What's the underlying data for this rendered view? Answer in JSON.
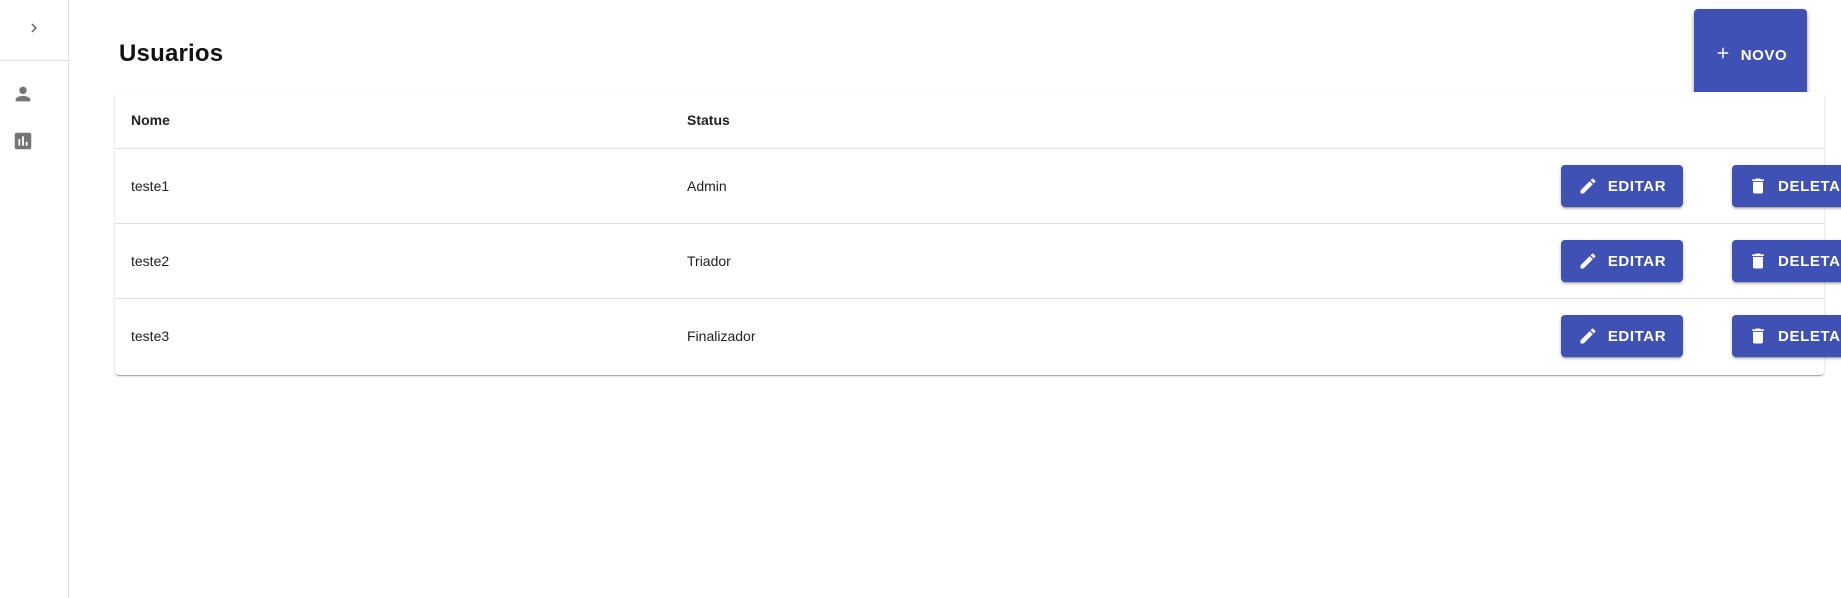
{
  "sidebar": {
    "toggle_icon": "chevron-right-icon",
    "items": [
      {
        "icon": "person-icon"
      },
      {
        "icon": "bar-chart-icon"
      }
    ]
  },
  "page": {
    "title": "Usuarios",
    "new_button_label": "NOVO"
  },
  "table": {
    "columns": [
      "Nome",
      "Status"
    ],
    "rows": [
      {
        "name": "teste1",
        "status": "Admin"
      },
      {
        "name": "teste2",
        "status": "Triador"
      },
      {
        "name": "teste3",
        "status": "Finalizador"
      }
    ],
    "edit_label": "EDITAR",
    "delete_label": "DELETAR"
  },
  "colors": {
    "primary": "#3f51b5",
    "icon_gray": "#757575"
  }
}
